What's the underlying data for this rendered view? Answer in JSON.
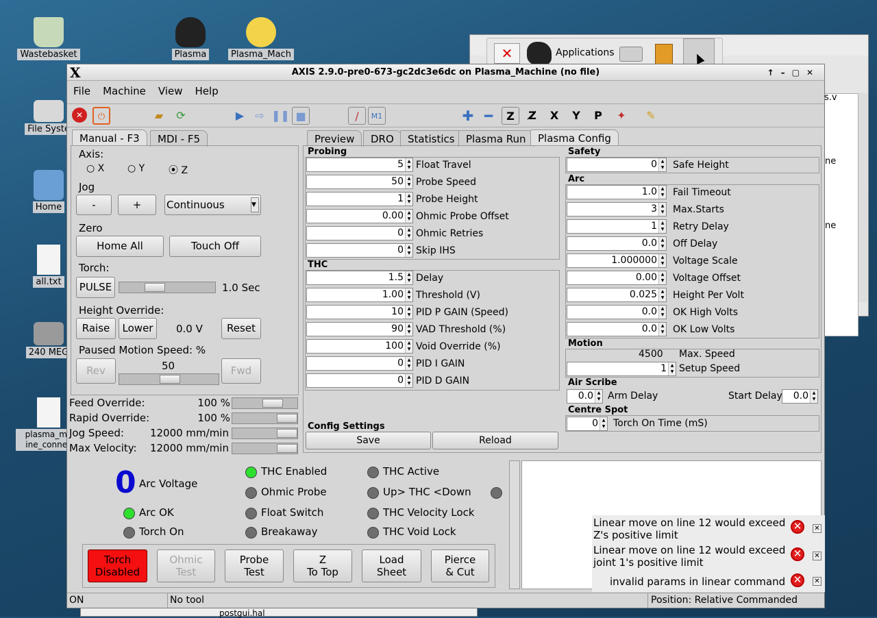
{
  "desktop": {
    "icons": [
      "Wastebasket",
      "File Syste",
      "Home",
      "all.txt",
      "240 MEG",
      "plasma_ma ine_connec",
      "Plasma",
      "Plasma_Mach"
    ]
  },
  "panel": {
    "applications": "Applications"
  },
  "bg_window": {
    "text1": "s.v",
    "text2": "ne",
    "text3": "ne",
    "postgui": "postgui.hal"
  },
  "window": {
    "title": "AXIS 2.9.0-pre0-673-gc2dc3e6dc on Plasma_Machine (no file)",
    "logo": "X"
  },
  "menu": [
    "File",
    "Machine",
    "View",
    "Help"
  ],
  "left_tabs": [
    "Manual - F3",
    "MDI - F5"
  ],
  "manual": {
    "axis_label": "Axis:",
    "axes": [
      "X",
      "Y",
      "Z"
    ],
    "selected_axis": "Z",
    "jog_label": "Jog",
    "jog_minus": "-",
    "jog_plus": "+",
    "jog_mode": "Continuous",
    "zero_label": "Zero",
    "home_all": "Home All",
    "touch_off": "Touch Off",
    "torch_label": "Torch:",
    "pulse": "PULSE",
    "pulse_time": "1.0 Sec",
    "height_override_label": "Height Override:",
    "raise": "Raise",
    "lower": "Lower",
    "height_value": "0.0 V",
    "reset": "Reset",
    "paused_label": "Paused Motion Speed: %",
    "paused_value": "50",
    "rev": "Rev",
    "fwd": "Fwd"
  },
  "overrides": [
    {
      "label": "Feed Override:",
      "value": "100 %",
      "level": 0.67
    },
    {
      "label": "Rapid Override:",
      "value": "100 %",
      "level": 1.0
    },
    {
      "label": "Jog Speed:",
      "value": "12000 mm/min",
      "level": 1.0
    },
    {
      "label": "Max Velocity:",
      "value": "12000 mm/min",
      "level": 1.0
    }
  ],
  "right_tabs": [
    "Preview",
    "DRO",
    "Statistics",
    "Plasma Run",
    "Plasma Config"
  ],
  "probing": {
    "title": "Probing",
    "rows": [
      {
        "value": "5",
        "label": "Float Travel"
      },
      {
        "value": "50",
        "label": "Probe Speed"
      },
      {
        "value": "1",
        "label": "Probe Height"
      },
      {
        "value": "0.00",
        "label": "Ohmic Probe Offset"
      },
      {
        "value": "0",
        "label": "Ohmic Retries"
      },
      {
        "value": "0",
        "label": "Skip IHS"
      }
    ]
  },
  "thc": {
    "title": "THC",
    "rows": [
      {
        "value": "1.5",
        "label": "Delay"
      },
      {
        "value": "1.00",
        "label": "Threshold (V)"
      },
      {
        "value": "10",
        "label": "PID P GAIN (Speed)"
      },
      {
        "value": "90",
        "label": "VAD Threshold (%)"
      },
      {
        "value": "100",
        "label": "Void Override (%)"
      },
      {
        "value": "0",
        "label": "PID I GAIN"
      },
      {
        "value": "0",
        "label": "PID D GAIN"
      }
    ]
  },
  "config_settings": {
    "title": "Config Settings",
    "save": "Save",
    "reload": "Reload"
  },
  "safety": {
    "title": "Safety",
    "value": "0",
    "label": "Safe Height"
  },
  "arc": {
    "title": "Arc",
    "rows": [
      {
        "value": "1.0",
        "label": "Fail Timeout"
      },
      {
        "value": "3",
        "label": "Max.Starts"
      },
      {
        "value": "1",
        "label": "Retry Delay"
      },
      {
        "value": "0.0",
        "label": "Off Delay"
      },
      {
        "value": "1.000000",
        "label": "Voltage Scale"
      },
      {
        "value": "0.00",
        "label": "Voltage Offset"
      },
      {
        "value": "0.025",
        "label": "Height Per Volt"
      },
      {
        "value": "0.0",
        "label": "OK High Volts"
      },
      {
        "value": "0.0",
        "label": "OK Low Volts"
      }
    ]
  },
  "motion": {
    "title": "Motion",
    "max_speed_value": "4500",
    "max_speed_label": "Max. Speed",
    "setup_value": "1",
    "setup_label": "Setup Speed"
  },
  "air_scribe": {
    "title": "Air Scribe",
    "arm_value": "0.0",
    "arm_label": "Arm Delay",
    "start_label": "Start Delay",
    "start_value": "0.0"
  },
  "centre_spot": {
    "title": "Centre Spot",
    "value": "0",
    "label": "Torch On Time (mS)"
  },
  "status": {
    "arc_voltage": "0",
    "arc_voltage_label": "Arc Voltage",
    "leds": [
      {
        "label": "Arc OK",
        "on": true
      },
      {
        "label": "Torch On",
        "on": false
      },
      {
        "label": "THC Enabled",
        "on": true
      },
      {
        "label": "Ohmic Probe",
        "on": false
      },
      {
        "label": "Float Switch",
        "on": false
      },
      {
        "label": "Breakaway",
        "on": false
      },
      {
        "label": "THC Active",
        "on": false
      },
      {
        "label": "Up> THC <Down",
        "on": false
      },
      {
        "label": "THC Velocity Lock",
        "on": false
      },
      {
        "label": "THC Void Lock",
        "on": false
      }
    ]
  },
  "buttons": {
    "torch": "Torch\nDisabled",
    "ohmic": "Ohmic\nTest",
    "probe": "Probe\nTest",
    "ztop": "Z\nTo Top",
    "load": "Load\nSheet",
    "pierce": "Pierce\n& Cut"
  },
  "errors": [
    "Linear move on line 12 would exceed Z's positive limit",
    "Linear move on line 12 would exceed joint 1's positive limit",
    "invalid params in linear command"
  ],
  "statusbar": {
    "state": "ON",
    "tool": "No tool",
    "position": "Position: Relative Commanded"
  },
  "colors": {
    "torch_disabled": "#f41010",
    "led_on": "#2ee02e",
    "arc_voltage": "#0a0ad0"
  }
}
